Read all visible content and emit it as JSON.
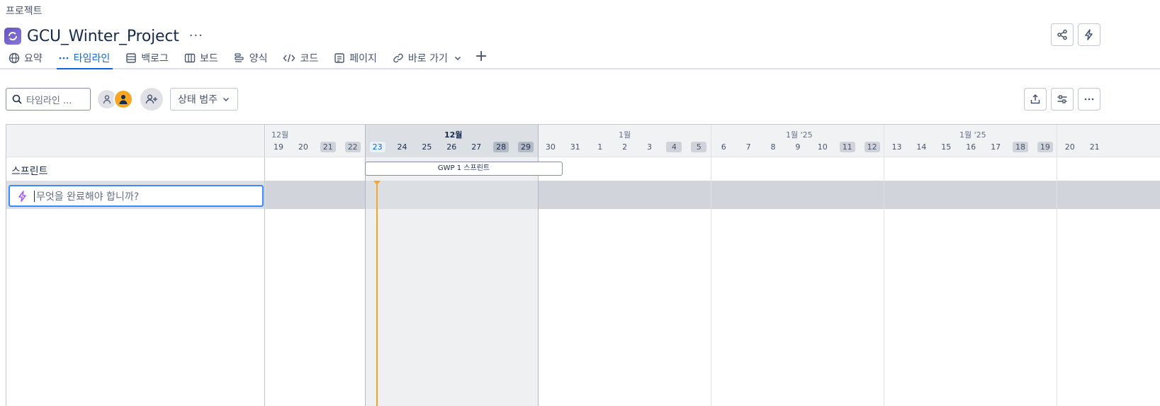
{
  "breadcrumb": "프로젝트",
  "project": {
    "title": "GCU_Winter_Project",
    "more": "···"
  },
  "tabs": [
    {
      "label": "요약",
      "icon": "globe-icon"
    },
    {
      "label": "타임라인",
      "icon": "timeline-icon",
      "active": true
    },
    {
      "label": "백로그",
      "icon": "backlog-icon"
    },
    {
      "label": "보드",
      "icon": "board-icon"
    },
    {
      "label": "양식",
      "icon": "form-icon"
    },
    {
      "label": "코드",
      "icon": "code-icon"
    },
    {
      "label": "페이지",
      "icon": "page-icon"
    },
    {
      "label": "바로 가기",
      "icon": "link-icon"
    }
  ],
  "toolbar": {
    "search_placeholder": "타임라인 ...",
    "status_filter": "상태 범주"
  },
  "left": {
    "sprint_label": "스프린트",
    "new_issue_placeholder": "무엇을 완료해야 합니까?"
  },
  "timeline": {
    "months": [
      "12월",
      "12월",
      "1월",
      "1월 '25",
      "1월 '25"
    ],
    "days": [
      "19",
      "20",
      "21",
      "22",
      "23",
      "24",
      "25",
      "26",
      "27",
      "28",
      "29",
      "30",
      "31",
      "1",
      "2",
      "3",
      "4",
      "5",
      "6",
      "7",
      "8",
      "9",
      "10",
      "11",
      "12",
      "13",
      "14",
      "15",
      "16",
      "17",
      "18",
      "19",
      "20",
      "21"
    ],
    "today": "23",
    "sprint_bar": "GWP 1 스프린트"
  },
  "colors": {
    "accent": "#0c66e4",
    "today": "#f5a623",
    "project_icon": "#6554c0"
  }
}
